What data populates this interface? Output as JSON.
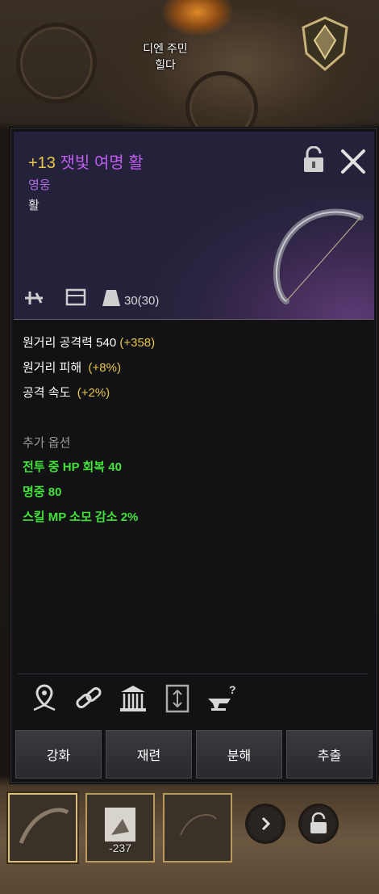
{
  "npc": {
    "title": "디엔 주민",
    "name": "힐다"
  },
  "item": {
    "enhance": "+13",
    "name": "잿빛 여명 활",
    "grade": "영웅",
    "type": "활",
    "weight": "30(30)"
  },
  "stats": [
    {
      "label": "원거리 공격력 540",
      "bonus": "(+358)"
    },
    {
      "label": "원거리 피해",
      "bonus": "(+8%)"
    },
    {
      "label": "공격 속도",
      "bonus": "(+2%)"
    }
  ],
  "extra": {
    "title": "추가 옵션",
    "options": [
      "전투 중 HP 회복 40",
      "명중 80",
      "스킬 MP 소모 감소 2%"
    ]
  },
  "buttons": {
    "enhance": "강화",
    "refine": "재련",
    "disassemble": "분해",
    "extract": "추출"
  },
  "slots": {
    "second_count": "-237"
  },
  "colors": {
    "grade_purple": "#c05cf0",
    "enhance_gold": "#e8c64a",
    "option_green": "#42e23a"
  }
}
